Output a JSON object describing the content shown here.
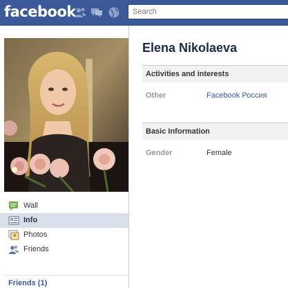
{
  "header": {
    "logo": "facebook",
    "search_placeholder": "Search"
  },
  "profile": {
    "name": "Elena Nikolaeva"
  },
  "nav": {
    "items": [
      {
        "label": "Wall",
        "icon": "wall-icon"
      },
      {
        "label": "Info",
        "icon": "info-icon",
        "active": true
      },
      {
        "label": "Photos",
        "icon": "photos-icon"
      },
      {
        "label": "Friends",
        "icon": "friends-icon"
      }
    ],
    "friends_heading": "Friends (1)"
  },
  "sections": {
    "activities": {
      "title": "Activities and interests",
      "rows": [
        {
          "label": "Other",
          "value": "Facebook Россия"
        }
      ]
    },
    "basic": {
      "title": "Basic Information",
      "rows": [
        {
          "label": "Gender",
          "value": "Female"
        }
      ]
    }
  },
  "colors": {
    "brand": "#3b5998",
    "active_nav_bg": "#d8dfea",
    "section_bg": "#f2f2f2"
  }
}
